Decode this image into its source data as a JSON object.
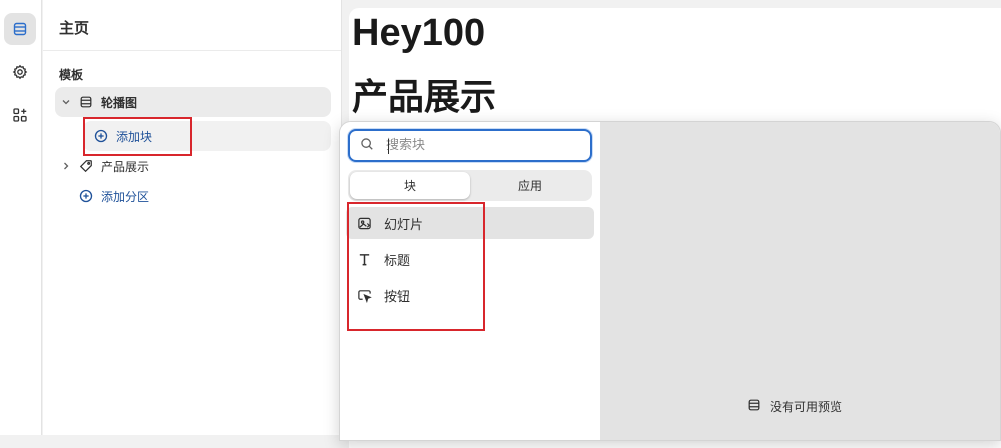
{
  "rail": {
    "items": [
      {
        "name": "sections-icon",
        "active": true
      },
      {
        "name": "settings-icon",
        "active": false
      },
      {
        "name": "apps-icon",
        "active": false
      }
    ]
  },
  "sidebar": {
    "title": "主页",
    "section_label": "模板",
    "tree": {
      "carousel": {
        "label": "轮播图",
        "icon": "carousel-icon",
        "expanded": true
      },
      "add_block": {
        "label": "添加块",
        "icon": "plus-circle-icon"
      },
      "product_showcase": {
        "label": "产品展示",
        "icon": "tag-icon",
        "expanded": false
      },
      "add_section": {
        "label": "添加分区",
        "icon": "plus-circle-icon"
      }
    }
  },
  "preview": {
    "heading": "Hey100",
    "subheading": "产品展示"
  },
  "picker": {
    "search": {
      "placeholder": "搜索块",
      "value": ""
    },
    "tabs": [
      {
        "label": "块",
        "active": true
      },
      {
        "label": "应用",
        "active": false
      }
    ],
    "blocks": [
      {
        "label": "幻灯片",
        "icon": "slideshow-icon",
        "hovered": true
      },
      {
        "label": "标题",
        "icon": "text-icon",
        "hovered": false
      },
      {
        "label": "按钮",
        "icon": "button-cursor-icon",
        "hovered": false
      }
    ],
    "preview_empty_text": "没有可用预览"
  },
  "colors": {
    "accent_blue": "#2c6ecb",
    "link_blue": "#1f5199",
    "annotation_red": "#d8262c",
    "panel_gray": "#e3e3e3",
    "page_bg": "#f1f1f1"
  }
}
